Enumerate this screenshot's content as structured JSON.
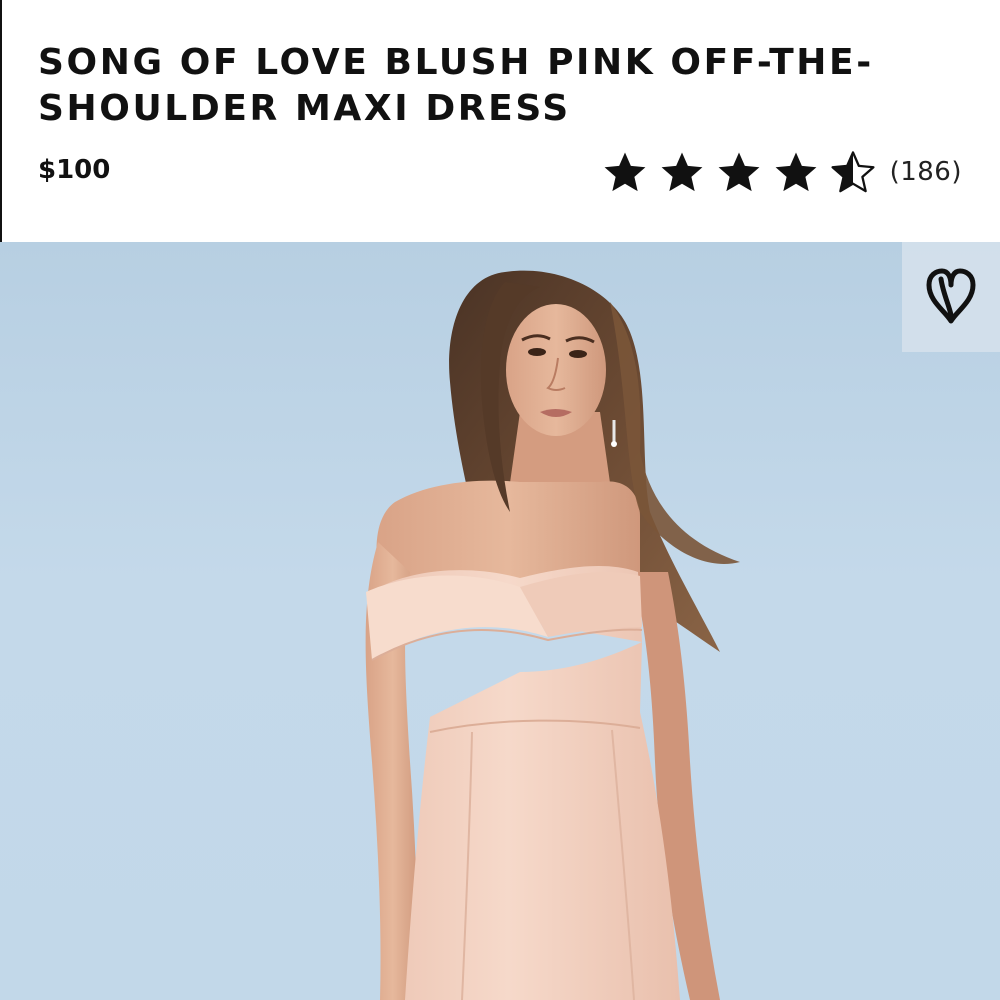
{
  "product": {
    "title": "SONG OF LOVE BLUSH PINK OFF-THE-SHOULDER MAXI DRESS",
    "price": "$100",
    "rating": 4.5,
    "rating_max": 5,
    "review_count": "(186)"
  },
  "icons": {
    "favorite": "heart-outline-icon",
    "star_full": "star-icon",
    "star_half": "star-half-icon"
  },
  "colors": {
    "text": "#111111",
    "photo_background": "#c2d8e9",
    "dress": "#f4d3c3"
  }
}
